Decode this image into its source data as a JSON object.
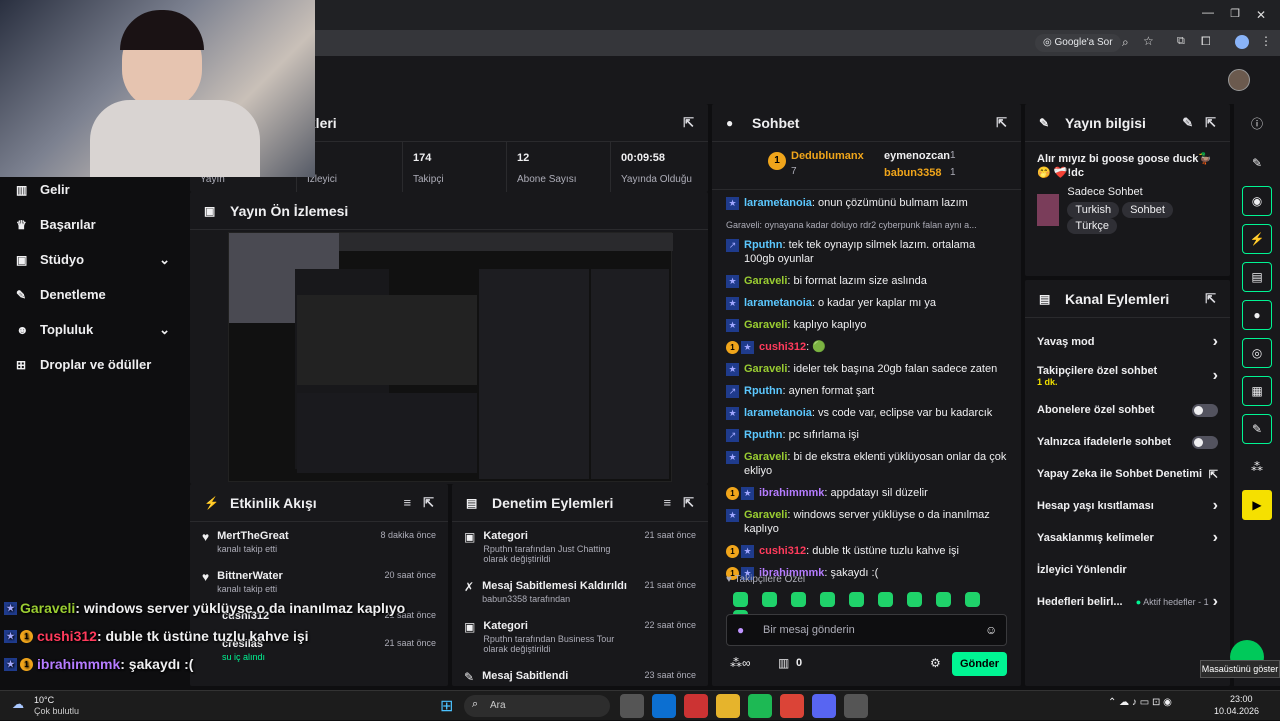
{
  "browser": {
    "google_sor": "Google'a Sor"
  },
  "sidebar": {
    "items": [
      {
        "label": "Gelir",
        "icon": "bars-chart-icon",
        "chev": ""
      },
      {
        "label": "Başarılar",
        "icon": "trophy-icon",
        "chev": ""
      },
      {
        "label": "Stüdyo",
        "icon": "studio-icon",
        "chev": "⌄"
      },
      {
        "label": "Denetleme",
        "icon": "wrench-icon",
        "chev": ""
      },
      {
        "label": "Topluluk",
        "icon": "people-icon",
        "chev": "⌄"
      },
      {
        "label": "Droplar ve ödüller",
        "icon": "gift-icon",
        "chev": ""
      }
    ]
  },
  "stats": {
    "title_partial": "ikleri",
    "items": [
      {
        "value": "",
        "label": "Yayın"
      },
      {
        "value": "",
        "label": "İzleyici"
      },
      {
        "value": "174",
        "label": "Takipçi"
      },
      {
        "value": "12",
        "label": "Abone Sayısı"
      },
      {
        "value": "00:09:58",
        "label": "Yayında Olduğu"
      }
    ]
  },
  "preview": {
    "title": "Yayın Ön İzlemesi"
  },
  "activity": {
    "title": "Etkinlik Akışı",
    "items": [
      {
        "name": "MertTheGreat",
        "desc": "kanalı takip etti",
        "time": "8 dakika önce"
      },
      {
        "name": "BittnerWater",
        "desc": "kanalı takip etti",
        "time": "20 saat önce"
      },
      {
        "name": "cushi312",
        "desc": "",
        "time": "21 saat önce"
      },
      {
        "name": "cresilas",
        "desc": "su iç alındı",
        "time": "21 saat önce"
      }
    ]
  },
  "mod": {
    "title": "Denetim Eylemleri",
    "items": [
      {
        "title": "Kategori",
        "line": "Rputhn tarafından Just Chatting olarak değiştirildi",
        "time": "21 saat önce"
      },
      {
        "title": "Mesaj Sabitlemesi Kaldırıldı",
        "line": "babun3358 tarafından",
        "time": "21 saat önce"
      },
      {
        "title": "Kategori",
        "line": "Rputhn tarafından Business Tour olarak değiştirildi",
        "time": "22 saat önce"
      },
      {
        "title": "Mesaj Sabitlendi",
        "line": "",
        "time": "23 saat önce"
      }
    ]
  },
  "chat": {
    "title": "Sohbet",
    "leaders": [
      {
        "rank": "1",
        "name": "Dedublumanx",
        "count": "7"
      },
      {
        "rank": "",
        "name": "eymenozcan",
        "count": "1"
      },
      {
        "rank": "",
        "name": "babun3358",
        "count": "1"
      }
    ],
    "reply_preview": "Garaveli: oynayana kadar doluyo rdr2 cyberpunk falan aynı a...",
    "messages": [
      {
        "b": [
          "sub"
        ],
        "user": "larametanoia",
        "color": "#5cc8ff",
        "text": "onun çözümünü bulmam lazım"
      },
      {
        "b": [
          "arrow"
        ],
        "user": "Rputhn",
        "color": "#5cc8ff",
        "text": "tek tek oynayıp silmek lazım. ortalama 100gb oyunlar"
      },
      {
        "b": [
          "sub"
        ],
        "user": "Garaveli",
        "color": "#9acd32",
        "text": "bi format lazım size aslında"
      },
      {
        "b": [
          "sub"
        ],
        "user": "larametanoia",
        "color": "#5cc8ff",
        "text": "o kadar yer kaplar mı ya"
      },
      {
        "b": [
          "sub"
        ],
        "user": "Garaveli",
        "color": "#9acd32",
        "text": "kaplıyo kaplıyo"
      },
      {
        "b": [
          "one",
          "sub"
        ],
        "user": "cushi312",
        "color": "#ff3b5c",
        "text": "🟢"
      },
      {
        "b": [
          "sub"
        ],
        "user": "Garaveli",
        "color": "#9acd32",
        "text": "ideler tek başına 20gb falan sadece zaten"
      },
      {
        "b": [
          "arrow"
        ],
        "user": "Rputhn",
        "color": "#5cc8ff",
        "text": "aynen format şart"
      },
      {
        "b": [
          "sub"
        ],
        "user": "larametanoia",
        "color": "#5cc8ff",
        "text": "vs code var, eclipse var bu kadarcık"
      },
      {
        "b": [
          "arrow"
        ],
        "user": "Rputhn",
        "color": "#5cc8ff",
        "text": "pc sıfırlama işi"
      },
      {
        "b": [
          "sub"
        ],
        "user": "Garaveli",
        "color": "#9acd32",
        "text": "bi de ekstra eklenti yüklüyosan onlar da çok ekliyo"
      },
      {
        "b": [
          "one",
          "sub"
        ],
        "user": "ibrahimmmk",
        "color": "#b57cff",
        "text": "appdatayı sil düzelir"
      },
      {
        "b": [
          "sub"
        ],
        "user": "Garaveli",
        "color": "#9acd32",
        "text": "windows server yüklüyse o da inanılmaz kaplıyo"
      },
      {
        "b": [
          "one",
          "sub"
        ],
        "user": "cushi312",
        "color": "#ff3b5c",
        "text": "duble tk üstüne tuzlu kahve işi"
      },
      {
        "b": [
          "one",
          "sub"
        ],
        "user": "ibrahimmmk",
        "color": "#b57cff",
        "text": "şakaydı :("
      }
    ],
    "followers_only": "Takipçilere Özel",
    "placeholder": "Bir mesaj gönderin",
    "points": "0",
    "send": "Gönder"
  },
  "info": {
    "title": "Yayın bilgisi",
    "stream_title": "Alır mıyız bi goose goose duck🦆🤭 ❤️‍🩹!dc",
    "category": "Sadece Sohbet",
    "tags": [
      "Turkish",
      "Sohbet",
      "Türkçe"
    ]
  },
  "channel": {
    "title": "Kanal Eylemleri",
    "items": [
      {
        "label": "Yavaş mod",
        "sub": "",
        "ctl": "chev"
      },
      {
        "label": "Takipçilere özel sohbet",
        "sub": "1 dk.",
        "ctl": "chev"
      },
      {
        "label": "Abonelere özel sohbet",
        "sub": "",
        "ctl": "toggle"
      },
      {
        "label": "Yalnızca ifadelerle sohbet",
        "sub": "",
        "ctl": "toggle"
      },
      {
        "label": "Yapay Zeka ile Sohbet Denetimi",
        "sub": "",
        "ctl": "ext"
      },
      {
        "label": "Hesap yaşı kısıtlaması",
        "sub": "",
        "ctl": "chev"
      },
      {
        "label": "Yasaklanmış kelimeler",
        "sub": "",
        "ctl": "chev"
      },
      {
        "label": "İzleyici Yönlendir",
        "sub": "",
        "ctl": ""
      },
      {
        "label": "Hedefleri belirl...",
        "sub": "",
        "ctl": "goal"
      }
    ],
    "goal_status": "Aktif hedefler - 1"
  },
  "overlay": [
    {
      "user": "Garaveli",
      "color": "#9acd32",
      "text": " : windows server yüklüyse o da inanılmaz kaplıyo",
      "one": false
    },
    {
      "user": "cushi312",
      "color": "#ff3b5c",
      "text": " : duble tk üstüne tuzlu kahve işi",
      "one": true
    },
    {
      "user": "ibrahimmmk",
      "color": "#b57cff",
      "text": " : şakaydı :(",
      "one": true
    }
  ],
  "tooltip": "Masaüstünü göster",
  "taskbar": {
    "temp": "10°C",
    "weather": "Çok bulutlu",
    "search": "Ara",
    "time": "23:00",
    "date": "10.04.2026"
  },
  "colors": {
    "accent": "#00f593",
    "twitch_bg": "#18181b",
    "page_bg": "#0e0e10"
  }
}
